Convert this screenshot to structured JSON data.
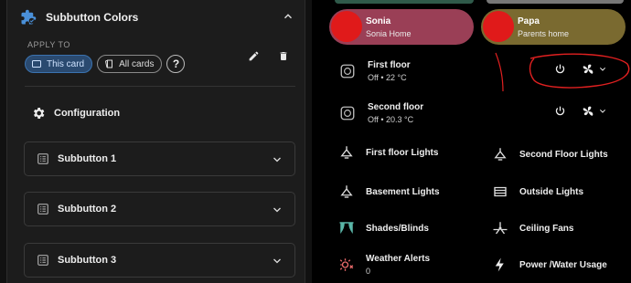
{
  "editor": {
    "section_title": "Subbutton Colors",
    "apply_to_label": "APPLY TO",
    "chips": [
      {
        "label": "This card",
        "selected": true
      },
      {
        "label": "All cards",
        "selected": false
      }
    ],
    "help_glyph": "?",
    "configuration_label": "Configuration",
    "subbuttons": [
      {
        "label": "Subbutton 1"
      },
      {
        "label": "Subbutton 2"
      },
      {
        "label": "Subbutton 3"
      }
    ],
    "accent_color": "#4a90d9"
  },
  "dashboard": {
    "persons": [
      {
        "name": "Sonia",
        "state": "Sonia Home",
        "color": "#9a3f56"
      },
      {
        "name": "Papa",
        "state": "Parents home",
        "color": "#7a6a30"
      }
    ],
    "thermostats": [
      {
        "name": "First floor",
        "state": "Off • 22 °C"
      },
      {
        "name": "Second floor",
        "state": "Off • 20.3 °C"
      }
    ],
    "tiles": [
      {
        "name": "First floor Lights",
        "icon": "ceiling-light-icon"
      },
      {
        "name": "Second Floor Lights",
        "icon": "ceiling-light-icon"
      },
      {
        "name": "Basement Lights",
        "icon": "ceiling-light-icon"
      },
      {
        "name": "Outside Lights",
        "icon": "wall-light-icon"
      },
      {
        "name": "Shades/Blinds",
        "icon": "curtains-icon"
      },
      {
        "name": "Ceiling Fans",
        "icon": "ceiling-fan-icon"
      },
      {
        "name": "Weather Alerts",
        "state": "0",
        "icon": "weather-alert-icon"
      },
      {
        "name": "Power /Water Usage",
        "icon": "lightning-bolt-icon"
      }
    ],
    "annotation_color": "#e02020"
  }
}
